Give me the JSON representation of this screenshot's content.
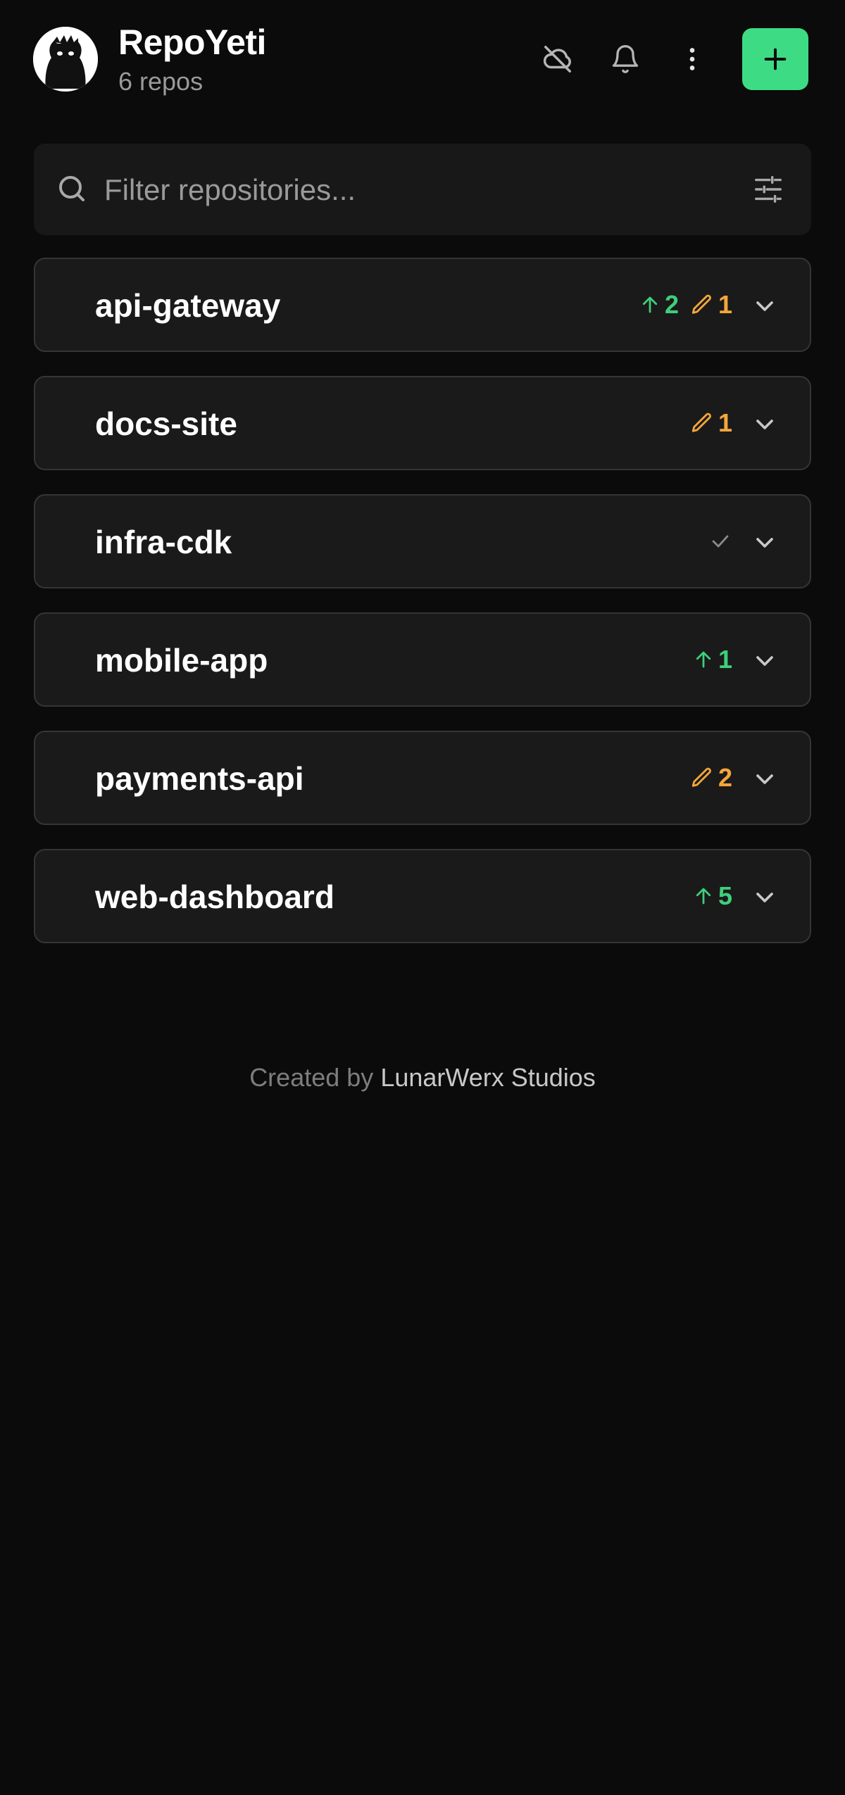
{
  "header": {
    "app_name": "RepoYeti",
    "repo_count": "6 repos",
    "avatar_icon": "yeti-avatar",
    "actions": [
      {
        "icon": "cloud-off-icon"
      },
      {
        "icon": "bell-icon"
      },
      {
        "icon": "more-vertical-icon"
      },
      {
        "icon": "plus-icon"
      }
    ],
    "accent_color": "#3ddc84"
  },
  "search": {
    "placeholder": "Filter repositories...",
    "value": "",
    "icon": "search-icon",
    "filter_icon": "sliders-icon"
  },
  "repos": [
    {
      "name": "api-gateway",
      "ahead": "2",
      "modified": "1"
    },
    {
      "name": "docs-site",
      "modified": "1"
    },
    {
      "name": "infra-cdk",
      "clean": true
    },
    {
      "name": "mobile-app",
      "ahead": "1"
    },
    {
      "name": "payments-api",
      "modified": "2"
    },
    {
      "name": "web-dashboard",
      "ahead": "5"
    }
  ],
  "colors": {
    "ahead": "#3ecf7a",
    "modified": "#f5a63b",
    "clean": "#8a8a8a"
  },
  "footer": {
    "prefix": "Created by",
    "studio": "LunarWerx Studios"
  }
}
